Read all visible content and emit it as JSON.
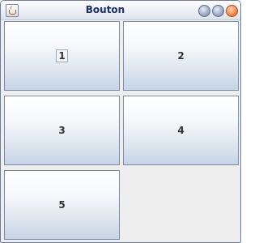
{
  "window": {
    "title": "Bouton",
    "app_icon": "java-cup-icon",
    "controls": [
      {
        "name": "minimize-button",
        "glyph": ""
      },
      {
        "name": "maximize-button",
        "glyph": ""
      },
      {
        "name": "close-button",
        "glyph": ""
      }
    ]
  },
  "buttons": [
    {
      "label": "1",
      "focused": true
    },
    {
      "label": "2",
      "focused": false
    },
    {
      "label": "3",
      "focused": false
    },
    {
      "label": "4",
      "focused": false
    },
    {
      "label": "5",
      "focused": false
    }
  ],
  "colors": {
    "title_text": "#1a2f6d",
    "close_accent": "#f08a4b",
    "button_border": "#7a8aa6"
  }
}
